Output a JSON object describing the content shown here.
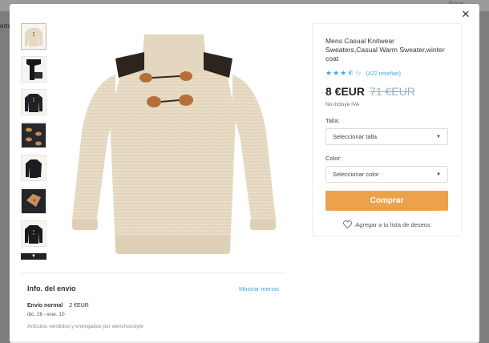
{
  "background": {
    "side_text": "erta",
    "search_hint": "Buscar"
  },
  "modal": {
    "close_glyph": "✕",
    "thumbnails": [
      {
        "icon": "sweater-front-thumb"
      },
      {
        "icon": "sweater-sleeve-thumb"
      },
      {
        "icon": "sweater-black-thumb"
      },
      {
        "icon": "toggle-buttons-thumb"
      },
      {
        "icon": "sweater-black-side-thumb"
      },
      {
        "icon": "shoulder-patch-thumb"
      },
      {
        "icon": "sweater-black-back-thumb"
      }
    ],
    "thumbs_more_glyph": "▼"
  },
  "product": {
    "title": "Mens Casual Knitwear Sweaters,Casual Warm Sweater,winter coat",
    "stars": "★★★⯪☆",
    "rating_value": 3.5,
    "reviews": "(422 reseñas)",
    "price": "8 €EUR",
    "old_price": "71 €EUR",
    "tax_note": "No incluye IVA",
    "size_label": "Talla:",
    "size_value": "Seleccionar talla",
    "color_label": "Color:",
    "color_value": "Seleccionar color",
    "buy_label": "Comprar",
    "wishlist_label": "Agregar a tu lista de deseos"
  },
  "shipping": {
    "title": "Info. del envío",
    "toggle": "Mostrar menos",
    "method": "Envío normal",
    "cost": "2 €EUR",
    "dates": "dic. 26 - ene. 10",
    "seller": "Artículos vendidos y entregados por wenzhoustyle"
  },
  "colors": {
    "accent": "#eca24a",
    "link": "#46a6d8",
    "sweater": "#e8dcc6",
    "dark_sweater": "#1e2126"
  }
}
